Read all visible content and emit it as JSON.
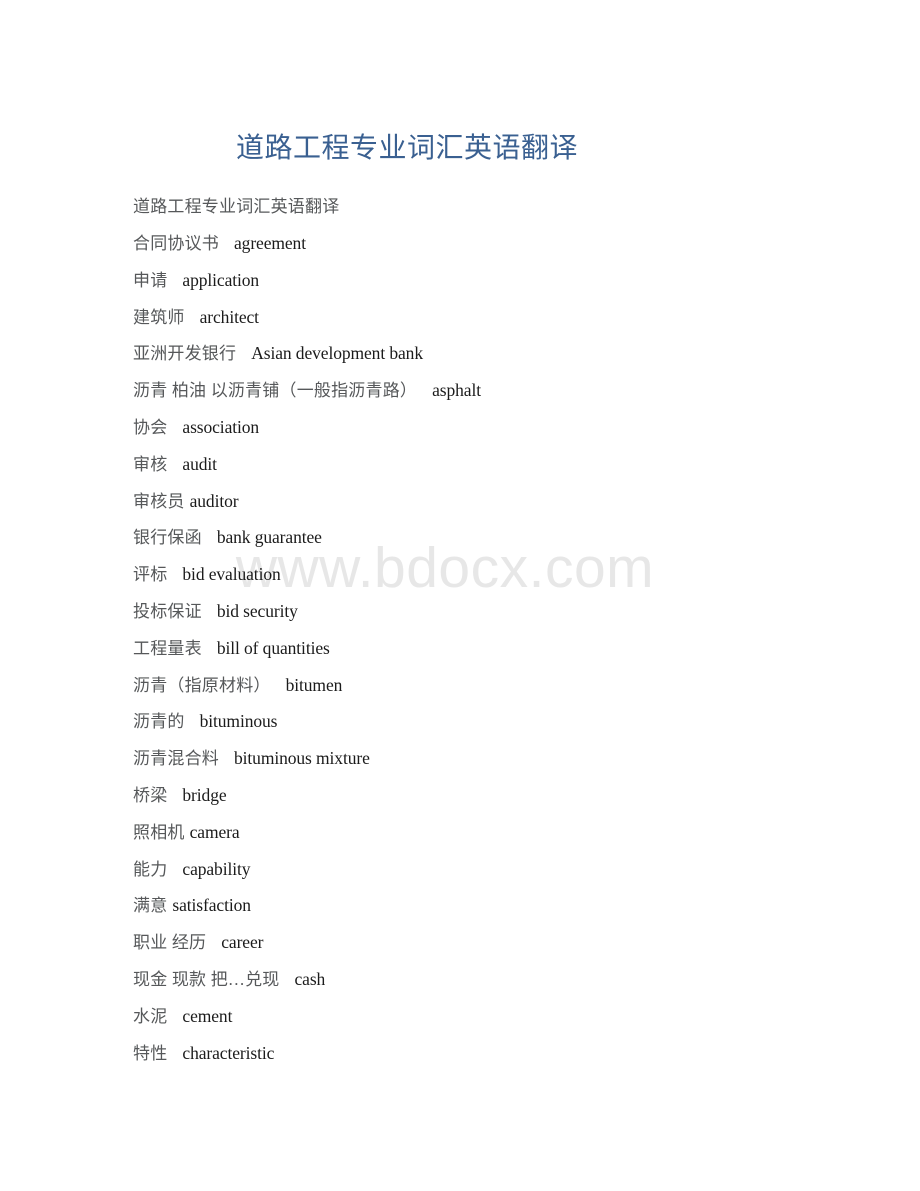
{
  "document": {
    "title": "道路工程专业词汇英语翻译",
    "intro_line": "道路工程专业词汇英语翻译",
    "watermark": "www.bdocx.com",
    "colors": {
      "title": "#3a6091",
      "chinese_text": "#56585a",
      "english_text": "#1b1b1b",
      "watermark": "#e7e7e7",
      "page_background": "#ffffff"
    }
  },
  "entries": [
    {
      "cn": "合同协议书",
      "en": "agreement",
      "gap": "wide"
    },
    {
      "cn": "申请",
      "en": "application",
      "gap": "wide"
    },
    {
      "cn": "建筑师",
      "en": "architect",
      "gap": "wide"
    },
    {
      "cn": "亚洲开发银行",
      "en": "Asian development bank",
      "gap": "wide"
    },
    {
      "cn": "沥青 柏油 以沥青铺（一般指沥青路）",
      "en": "asphalt",
      "gap": "wide"
    },
    {
      "cn": "协会",
      "en": "association",
      "gap": "wide"
    },
    {
      "cn": "审核",
      "en": "audit",
      "gap": "wide"
    },
    {
      "cn": "审核员",
      "en": "auditor",
      "gap": "narrow"
    },
    {
      "cn": "银行保函",
      "en": "bank guarantee",
      "gap": "wide"
    },
    {
      "cn": "评标",
      "en": "bid evaluation",
      "gap": "wide"
    },
    {
      "cn": "投标保证",
      "en": "bid security",
      "gap": "wide"
    },
    {
      "cn": "工程量表",
      "en": "bill of quantities",
      "gap": "wide"
    },
    {
      "cn": "沥青（指原材料）",
      "en": "bitumen",
      "gap": "wide"
    },
    {
      "cn": "沥青的",
      "en": "bituminous",
      "gap": "wide"
    },
    {
      "cn": "沥青混合料",
      "en": "bituminous mixture",
      "gap": "wide"
    },
    {
      "cn": "桥梁",
      "en": "bridge",
      "gap": "wide"
    },
    {
      "cn": "照相机",
      "en": "camera",
      "gap": "narrow"
    },
    {
      "cn": "能力",
      "en": "capability",
      "gap": "wide"
    },
    {
      "cn": "满意",
      "en": "satisfaction",
      "gap": "narrow"
    },
    {
      "cn": "职业 经历",
      "en": "career",
      "gap": "wide"
    },
    {
      "cn": "现金 现款 把…兑现",
      "en": "cash",
      "gap": "wide"
    },
    {
      "cn": "水泥",
      "en": "cement",
      "gap": "wide"
    },
    {
      "cn": "特性",
      "en": "characteristic",
      "gap": "wide"
    }
  ]
}
